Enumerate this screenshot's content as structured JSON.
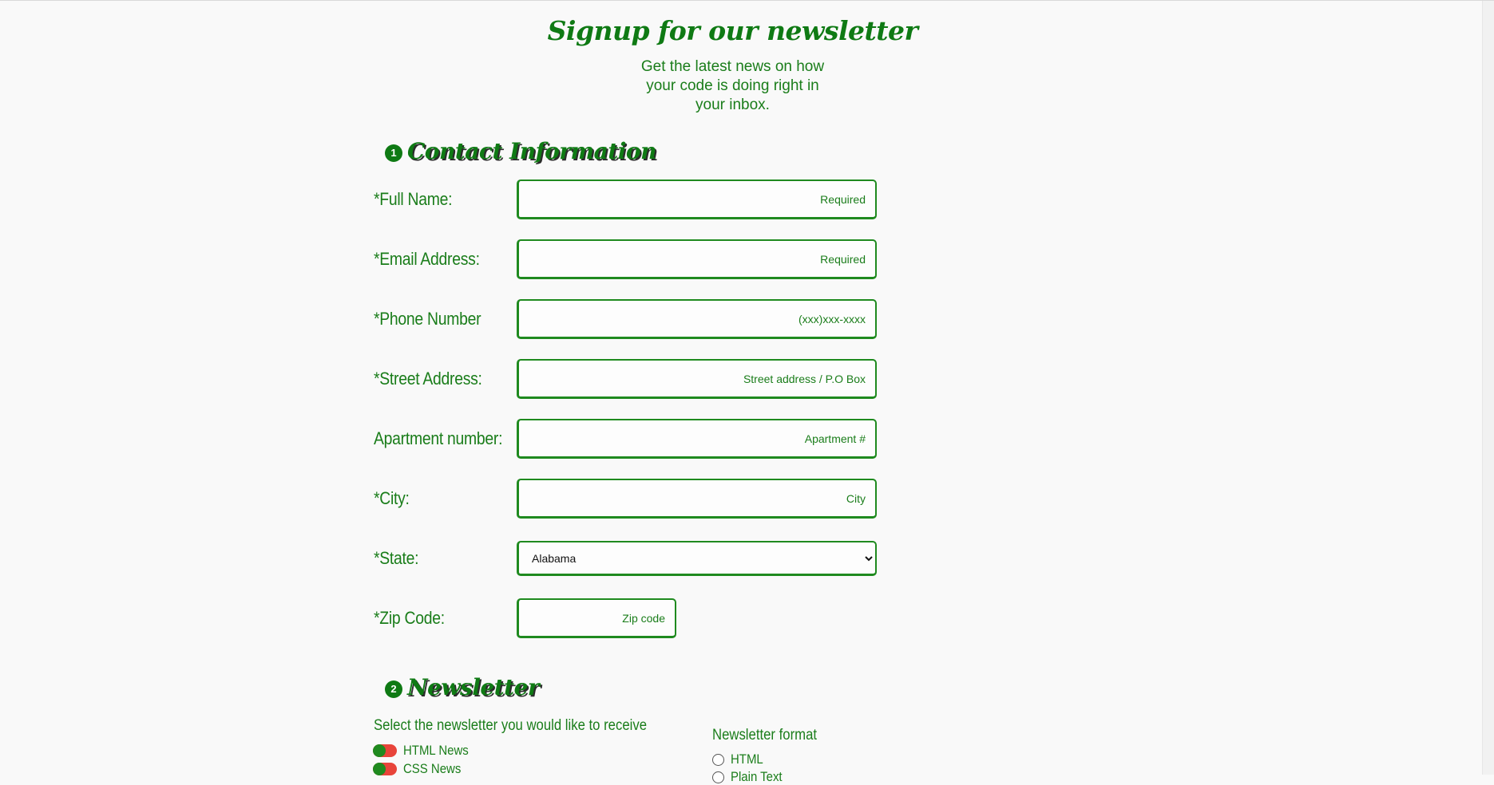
{
  "header": {
    "title": "Signup for our newsletter",
    "subtitle": "Get the latest news on how your code is doing right in your inbox."
  },
  "contact_section": {
    "step": "1",
    "title": "Contact Information",
    "fields": {
      "full_name": {
        "label": "*Full Name:",
        "placeholder": "Required",
        "value": ""
      },
      "email": {
        "label": "*Email Address:",
        "placeholder": "Required",
        "value": ""
      },
      "phone": {
        "label": "*Phone Number",
        "placeholder": "(xxx)xxx-xxxx",
        "value": ""
      },
      "street": {
        "label": "*Street Address:",
        "placeholder": "Street address / P.O Box",
        "value": ""
      },
      "apartment": {
        "label": "Apartment number:",
        "placeholder": "Apartment #",
        "value": ""
      },
      "city": {
        "label": "*City:",
        "placeholder": "City",
        "value": ""
      },
      "state": {
        "label": "*State:",
        "selected": "Alabama"
      },
      "zip": {
        "label": "*Zip Code:",
        "placeholder": "Zip code",
        "value": ""
      }
    }
  },
  "newsletter_section": {
    "step": "2",
    "title": "Newsletter",
    "intro": "Select the newsletter you would like to receive",
    "options": [
      {
        "label": "HTML News"
      },
      {
        "label": "CSS News"
      }
    ],
    "format_label": "Newsletter format",
    "formats": [
      {
        "label": "HTML"
      },
      {
        "label": "Plain Text"
      }
    ]
  },
  "colors": {
    "primary_green": "#0f7a14",
    "toggle_red": "#e8443a",
    "background": "#f9f9f9"
  }
}
